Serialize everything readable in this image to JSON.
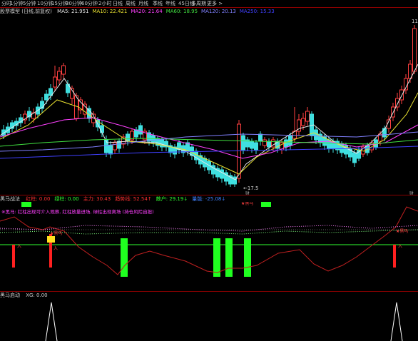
{
  "period_tabs": [
    "分时",
    "1分钟",
    "5分钟",
    "10分钟",
    "15分钟",
    "30分钟",
    "60分钟",
    "2小时",
    "日线",
    "周线",
    "月线",
    "季线",
    "年线",
    "45日线",
    "多周期",
    "更多"
  ],
  "period_more_label": "更多 >",
  "main": {
    "title": "股票模型 (日线,前复权)",
    "ma_values": [
      {
        "label": "MA5: 21.951",
        "color": "#e8e8e8"
      },
      {
        "label": "MA10: 22.421",
        "color": "#e8e030"
      },
      {
        "label": "MA20: 21.64",
        "color": "#ff40ff"
      },
      {
        "label": "MA60: 18.95",
        "color": "#40e040"
      },
      {
        "label": "MA120: 20.13",
        "color": "#8080ff"
      },
      {
        "label": "MA250: 15.33",
        "color": "#4040ff"
      }
    ],
    "right_edge_labels": [
      "11"
    ],
    "low_price_label": "←17.5",
    "low_bottom_marker": "财",
    "bottom_right_marker": "财"
  },
  "indicator1": {
    "title": "黑马战法",
    "values": [
      {
        "label": "红柱: 0.00",
        "color": "#ff3030"
      },
      {
        "label": "绿柱: 0.00",
        "color": "#30ff30"
      },
      {
        "label": "主力: 30.43",
        "color": "#ff3030"
      },
      {
        "label": "趋势线: 52.54↑",
        "color": "#ff3030"
      },
      {
        "label": "散户: 29.19↓",
        "color": "#30ff30"
      },
      {
        "label": "量能: -25.08↓",
        "color": "#4080ff"
      }
    ],
    "note": "※黑马: 红柱出现可介入观察, 红柱放量进场, 绿柱出现离场 (持仓风险自担)",
    "tags": {
      "buy1": "★黑马",
      "buy2": "★黑马",
      "buy3": "★黑马",
      "entry1": "入",
      "entry2": "入",
      "entry3": "入"
    }
  },
  "indicator2": {
    "title": "黑马启动",
    "values": [
      {
        "label": "XG: 0.00",
        "color": "#d0d0d0"
      }
    ]
  },
  "chart_data": {
    "type": "candlestick",
    "series": [
      {
        "name": "MA5",
        "color": "#e8e8e8"
      },
      {
        "name": "MA10",
        "color": "#e8e030"
      },
      {
        "name": "MA20",
        "color": "#ff40ff"
      },
      {
        "name": "MA60",
        "color": "#40e040"
      },
      {
        "name": "MA120",
        "color": "#8080ff"
      },
      {
        "name": "MA250",
        "color": "#4040ff"
      }
    ],
    "ylim": [
      17,
      30
    ]
  }
}
